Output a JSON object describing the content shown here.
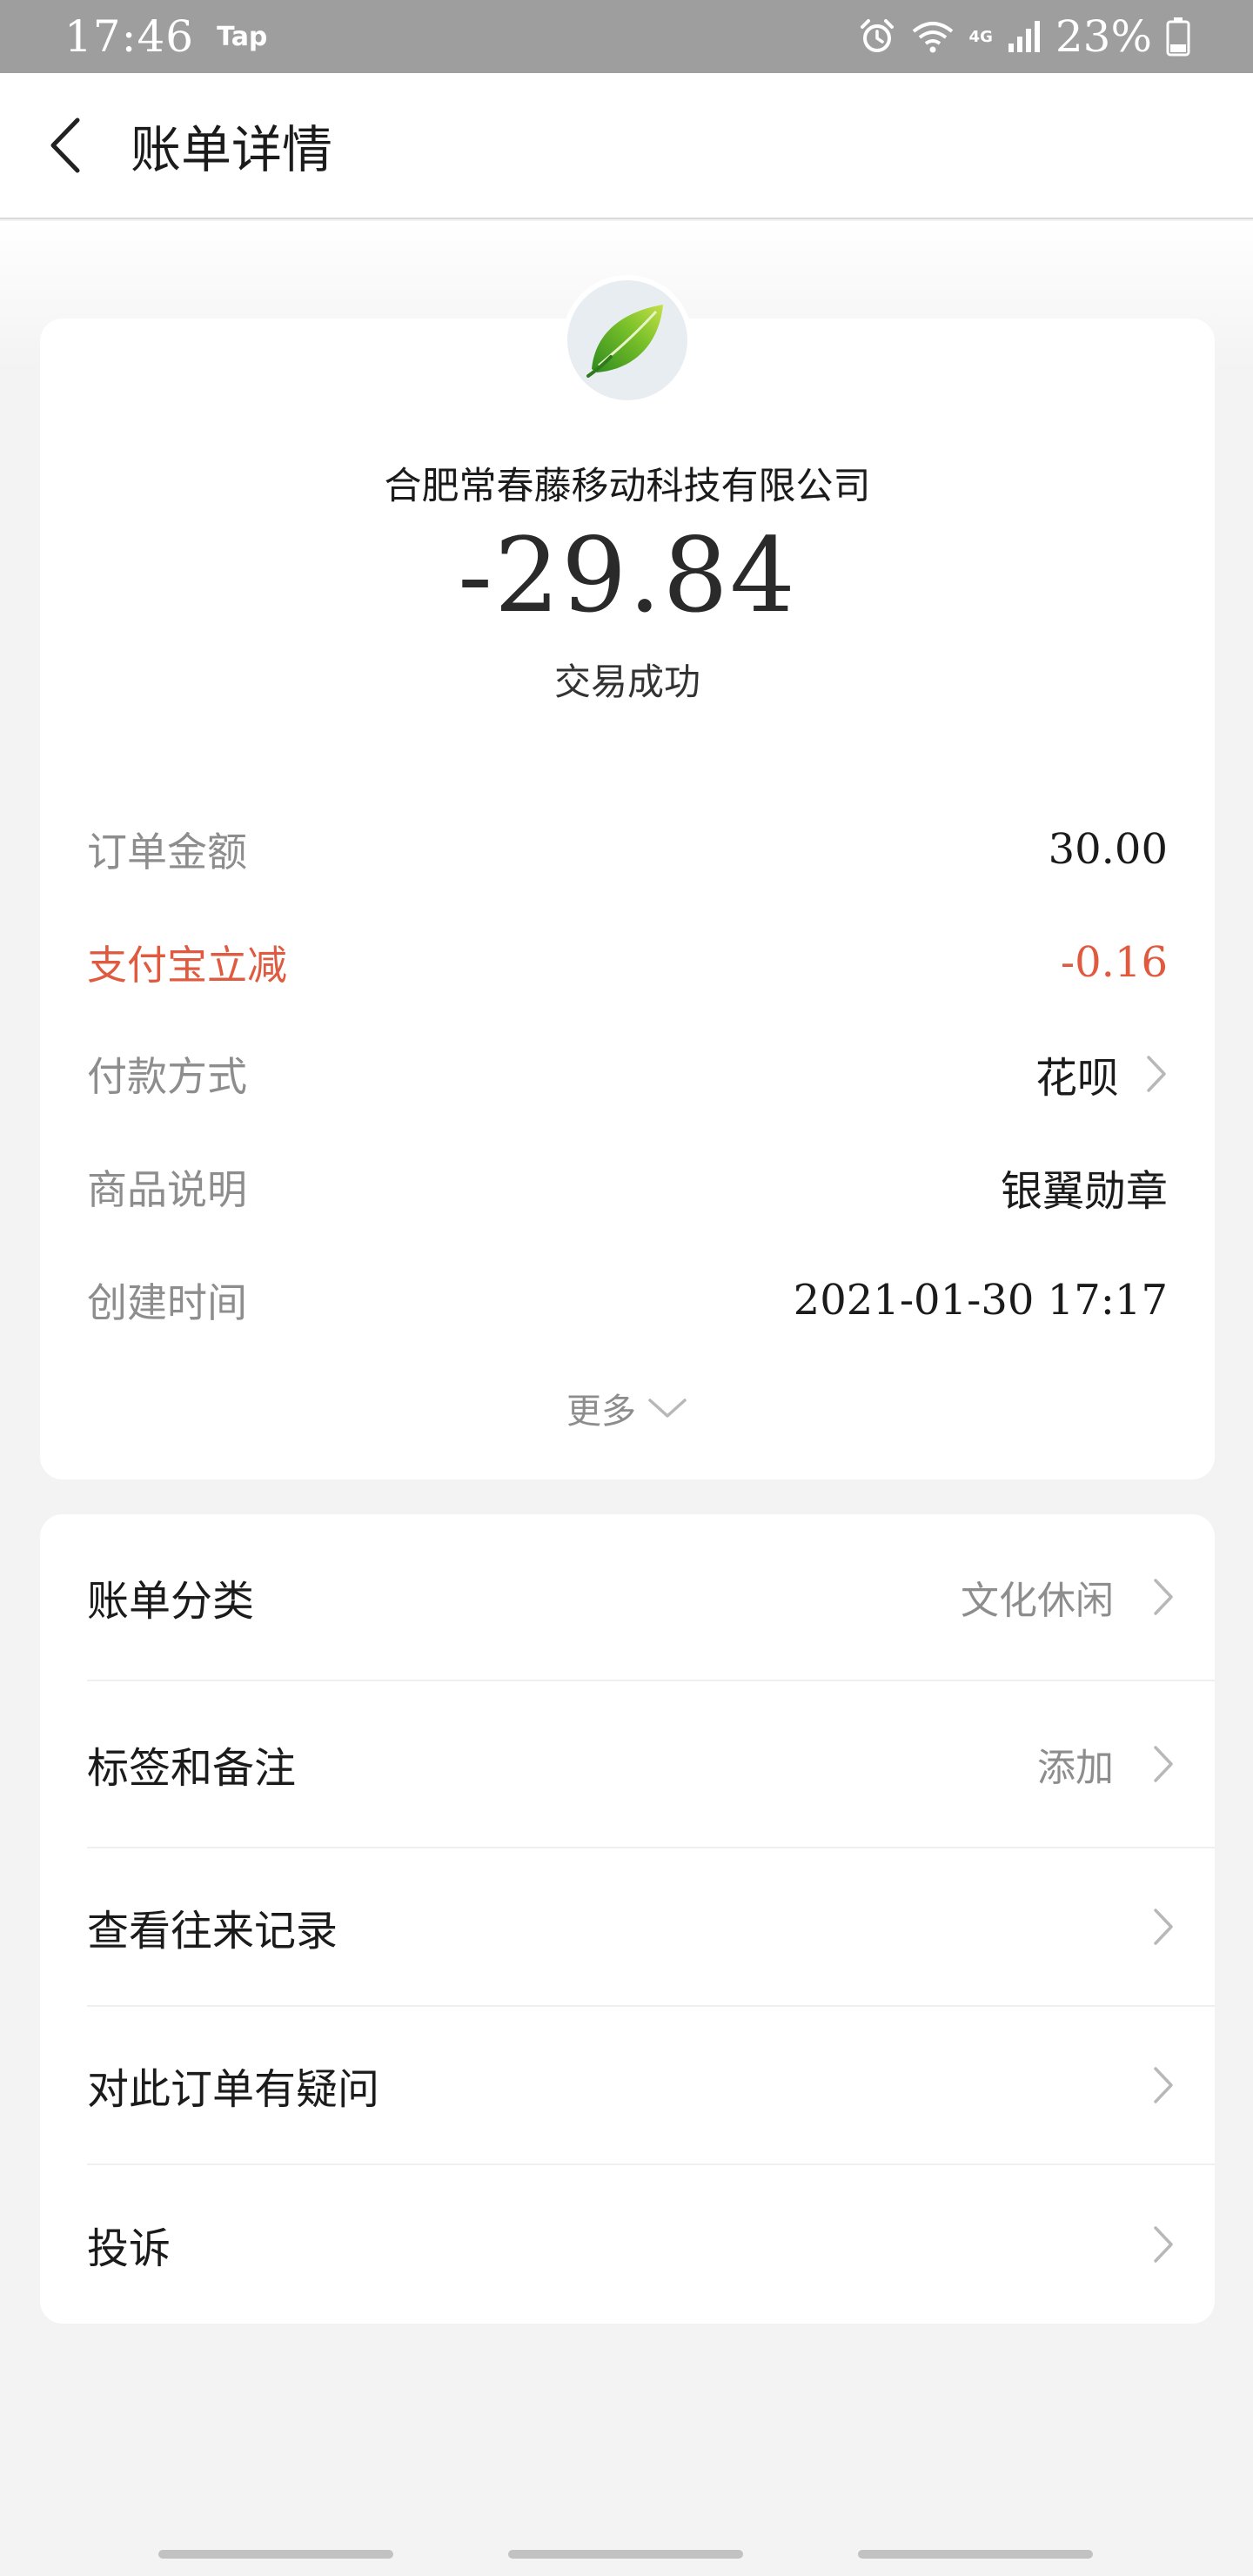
{
  "status_bar": {
    "time": "17:46",
    "app_badge": "Tap",
    "network": "4G",
    "battery": "23%"
  },
  "header": {
    "title": "账单详情"
  },
  "bill": {
    "merchant": "合肥常春藤移动科技有限公司",
    "amount": "-29.84",
    "status": "交易成功",
    "details": [
      {
        "label": "订单金额",
        "value": "30.00",
        "highlight": false,
        "arrow": false
      },
      {
        "label": "支付宝立减",
        "value": "-0.16",
        "highlight": true,
        "arrow": false
      },
      {
        "label": "付款方式",
        "value": "花呗",
        "highlight": false,
        "arrow": true
      },
      {
        "label": "商品说明",
        "value": "银翼勋章",
        "highlight": false,
        "arrow": false
      },
      {
        "label": "创建时间",
        "value": "2021-01-30 17:17",
        "highlight": false,
        "arrow": false
      }
    ],
    "more_label": "更多"
  },
  "actions": [
    {
      "label": "账单分类",
      "value": "文化休闲"
    },
    {
      "label": "标签和备注",
      "value": "添加"
    },
    {
      "label": "查看往来记录",
      "value": ""
    },
    {
      "label": "对此订单有疑问",
      "value": ""
    },
    {
      "label": "投诉",
      "value": ""
    }
  ],
  "colors": {
    "highlight": "#e05a3f",
    "secondary_text": "#8d8d8d",
    "primary_text": "#1b1b1b",
    "background": "#f3f3f3",
    "status_bar": "#9e9e9e"
  },
  "icons": {
    "back": "arrow-left-icon",
    "merchant_logo": "leaf-icon",
    "chevron": "chevron-right-icon",
    "expand": "chevron-down-icon"
  }
}
